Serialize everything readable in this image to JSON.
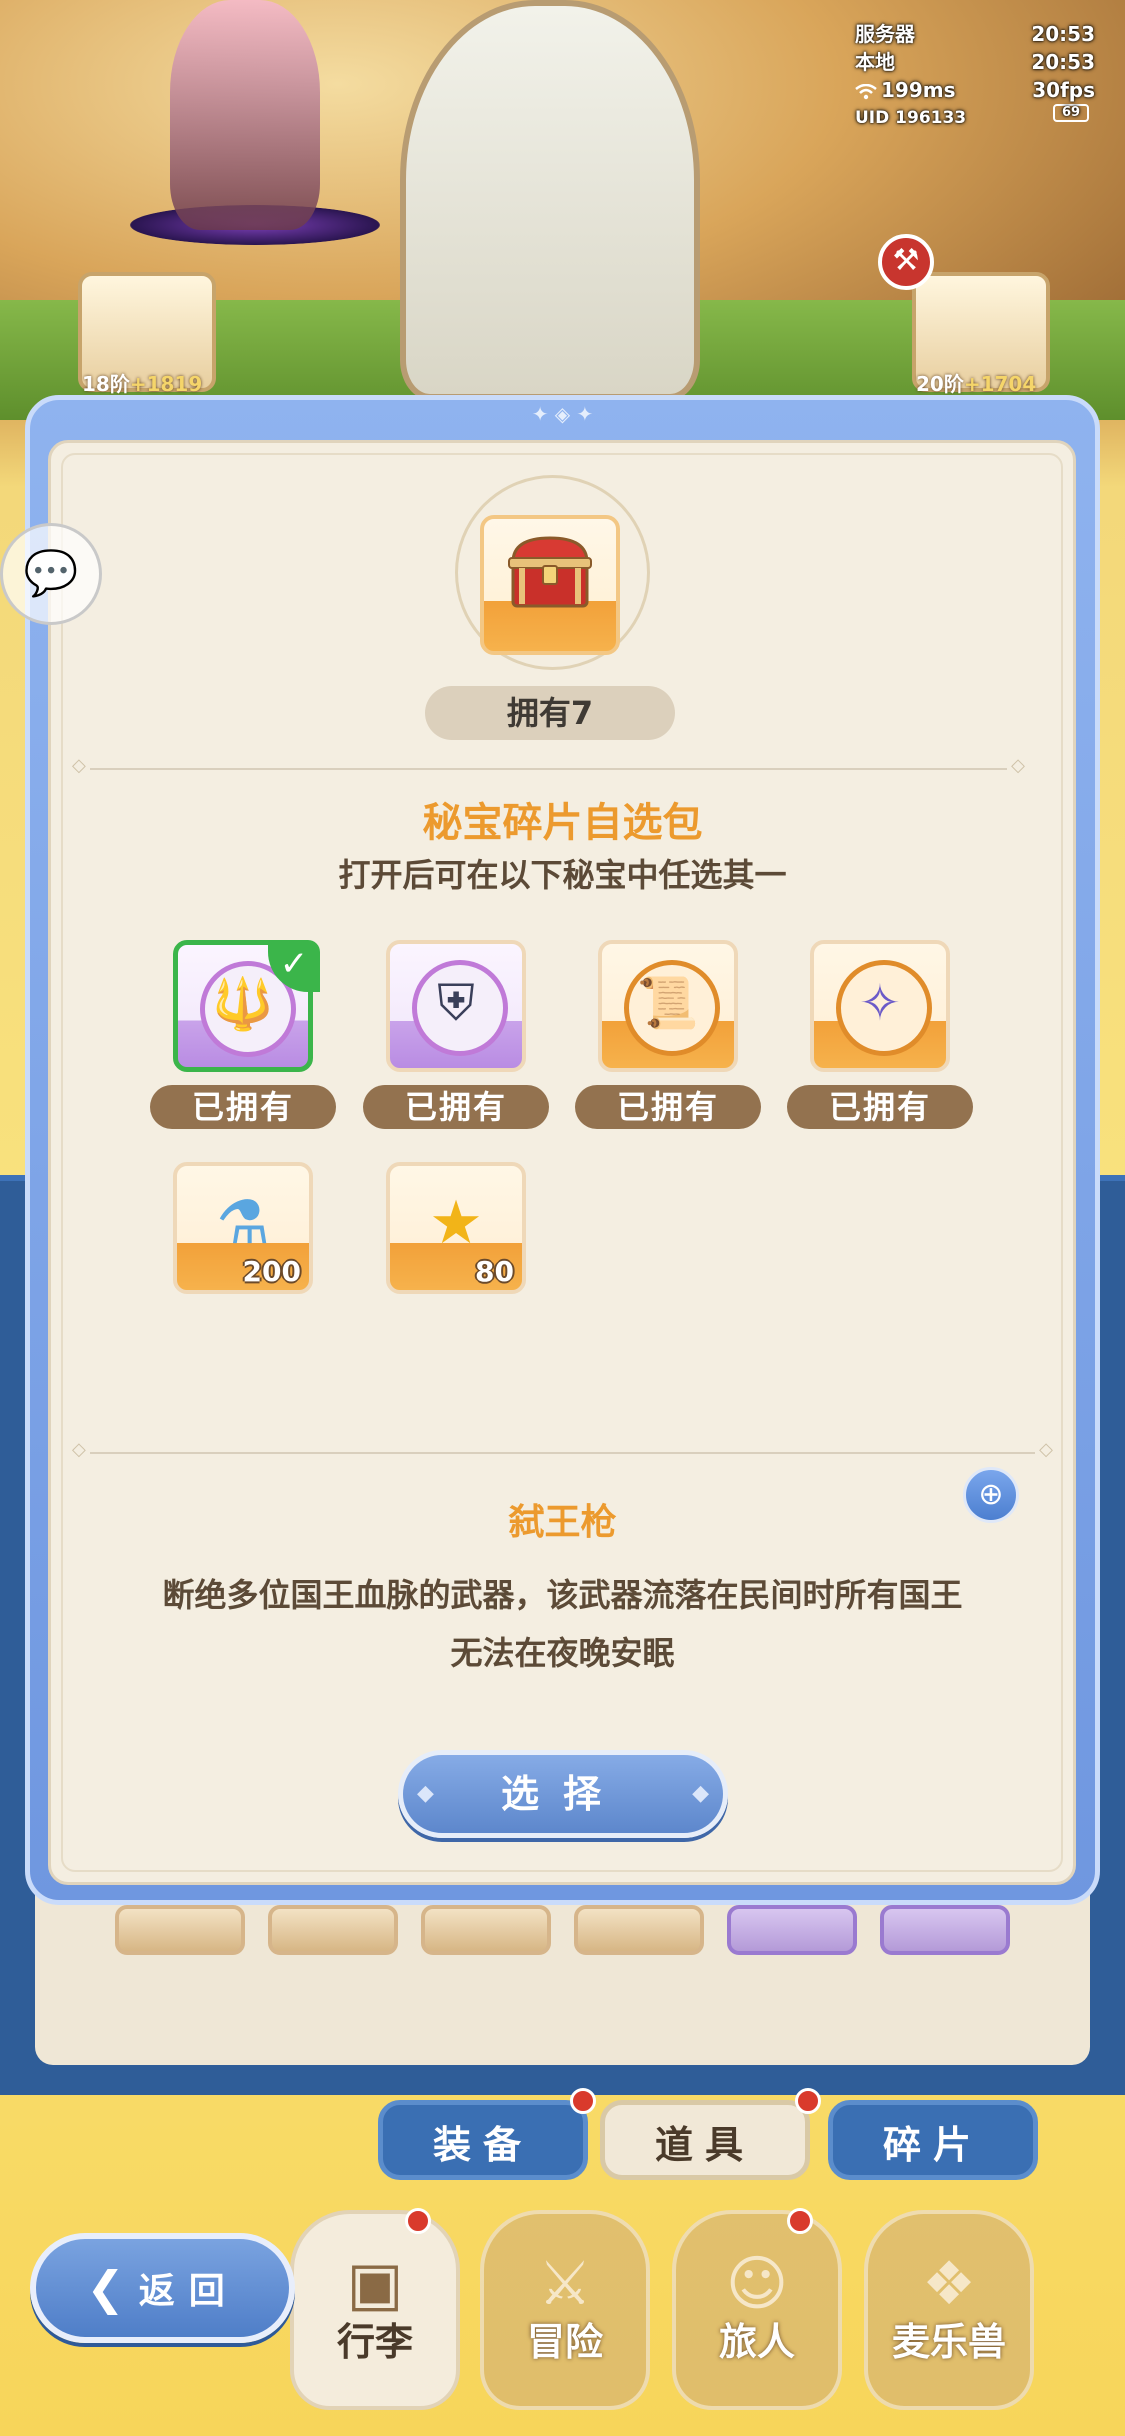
{
  "status": {
    "server_label": "服务器",
    "server_time": "20:53",
    "local_label": "本地",
    "local_time": "20:53",
    "ping": "199ms",
    "fps": "30fps",
    "uid": "UID 196133",
    "battery": "69"
  },
  "portraits": {
    "left_badge_stage": "18阶",
    "left_badge_power": "+1819",
    "right_badge_stage": "20阶",
    "right_badge_power": "+1704"
  },
  "modal": {
    "owned_count": "拥有7",
    "title": "秘宝碎片自选包",
    "subtitle": "打开后可在以下秘宝中任选其一",
    "options": [
      {
        "icon": "trident-icon",
        "owned_label": "已拥有",
        "selected": true
      },
      {
        "icon": "dark-shield-icon",
        "owned_label": "已拥有",
        "selected": false
      },
      {
        "icon": "scroll-tome-icon",
        "owned_label": "已拥有",
        "selected": false
      },
      {
        "icon": "crystal-staff-icon",
        "owned_label": "已拥有",
        "selected": false
      },
      {
        "icon": "potion-vial-icon",
        "quantity": "200"
      },
      {
        "icon": "gold-star-icon",
        "quantity": "80"
      }
    ],
    "detail_name": "弑王枪",
    "detail_desc_line1": "断绝多位国王血脉的武器，该武器流落在民间时所有国王",
    "detail_desc_line2": "无法在夜晚安眠",
    "select_label": "选择"
  },
  "tabs": {
    "equip": "装备",
    "items": "道具",
    "fragments": "碎片"
  },
  "nav": {
    "luggage": "行李",
    "adventure": "冒险",
    "traveler": "旅人",
    "beast": "麦乐兽"
  },
  "back_label": "返回"
}
